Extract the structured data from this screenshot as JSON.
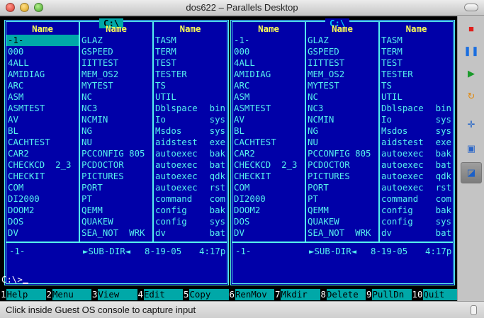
{
  "window": {
    "title": "dos622 – Parallels Desktop"
  },
  "panels": [
    {
      "path": "C:\\",
      "header": "Name",
      "columns": [
        [
          "-1-",
          "000",
          "4ALL",
          "AMIDIAG",
          "ARC",
          "ASM",
          "ASMTEST",
          "AV",
          "BL",
          "CACHTEST",
          "CAR2",
          "CHECKCD  2_3",
          "CHECKIT",
          "COM",
          "DI2000",
          "DOOM2",
          "DOS",
          "DV"
        ],
        [
          "GLAZ",
          "GSPEED",
          "IITTEST",
          "MEM_OS2",
          "MYTEST",
          "NC",
          "NC3",
          "NCMIN",
          "NG",
          "NU",
          "PCCONFIG 805",
          "PCDOCTOR",
          "PICTURES",
          "PORT",
          "PT",
          "QEMM",
          "QUAKEW",
          "SEA_NOT  WRK"
        ],
        [
          [
            "TASM",
            ""
          ],
          [
            "TERM",
            ""
          ],
          [
            "TEST",
            ""
          ],
          [
            "TESTER",
            ""
          ],
          [
            "TS",
            ""
          ],
          [
            "UTIL",
            ""
          ],
          [
            "Dblspace",
            "bin"
          ],
          [
            "Io",
            "sys"
          ],
          [
            "Msdos",
            "sys"
          ],
          [
            "aidstest",
            "exe"
          ],
          [
            "autoexec",
            "bak"
          ],
          [
            "autoexec",
            "bat"
          ],
          [
            "autoexec",
            "qdk"
          ],
          [
            "autoexec",
            "rst"
          ],
          [
            "command",
            "com"
          ],
          [
            "config",
            "bak"
          ],
          [
            "config",
            "sys"
          ],
          [
            "dv",
            "bat"
          ]
        ]
      ],
      "status": {
        "name": "-1-",
        "type": "►SUB-DIR◄",
        "date": "8-19-05",
        "time": "4:17p"
      }
    },
    {
      "path": "C:\\",
      "header": "Name",
      "columns": [
        [
          "-1-",
          "000",
          "4ALL",
          "AMIDIAG",
          "ARC",
          "ASM",
          "ASMTEST",
          "AV",
          "BL",
          "CACHTEST",
          "CAR2",
          "CHECKCD  2_3",
          "CHECKIT",
          "COM",
          "DI2000",
          "DOOM2",
          "DOS",
          "DV"
        ],
        [
          "GLAZ",
          "GSPEED",
          "IITTEST",
          "MEM_OS2",
          "MYTEST",
          "NC",
          "NC3",
          "NCMIN",
          "NG",
          "NU",
          "PCCONFIG 805",
          "PCDOCTOR",
          "PICTURES",
          "PORT",
          "PT",
          "QEMM",
          "QUAKEW",
          "SEA_NOT  WRK"
        ],
        [
          [
            "TASM",
            ""
          ],
          [
            "TERM",
            ""
          ],
          [
            "TEST",
            ""
          ],
          [
            "TESTER",
            ""
          ],
          [
            "TS",
            ""
          ],
          [
            "UTIL",
            ""
          ],
          [
            "Dblspace",
            "bin"
          ],
          [
            "Io",
            "sys"
          ],
          [
            "Msdos",
            "sys"
          ],
          [
            "aidstest",
            "exe"
          ],
          [
            "autoexec",
            "bak"
          ],
          [
            "autoexec",
            "bat"
          ],
          [
            "autoexec",
            "qdk"
          ],
          [
            "autoexec",
            "rst"
          ],
          [
            "command",
            "com"
          ],
          [
            "config",
            "bak"
          ],
          [
            "config",
            "sys"
          ],
          [
            "dv",
            "bat"
          ]
        ]
      ],
      "status": {
        "name": "-1-",
        "type": "►SUB-DIR◄",
        "date": "8-19-05",
        "time": "4:17p"
      }
    }
  ],
  "prompt": "C:\\>",
  "fkeys": [
    {
      "n": "1",
      "label": "Help"
    },
    {
      "n": "2",
      "label": "Menu"
    },
    {
      "n": "3",
      "label": "View"
    },
    {
      "n": "4",
      "label": "Edit"
    },
    {
      "n": "5",
      "label": "Copy"
    },
    {
      "n": "6",
      "label": "RenMov"
    },
    {
      "n": "7",
      "label": "Mkdir"
    },
    {
      "n": "8",
      "label": "Delete"
    },
    {
      "n": "9",
      "label": "PullDn"
    },
    {
      "n": "10",
      "label": "Quit"
    }
  ],
  "sidebar": [
    {
      "name": "stop-icon",
      "glyph": "■",
      "color": "#e0201c"
    },
    {
      "name": "pause-icon",
      "glyph": "❚❚",
      "color": "#1a6ee0"
    },
    {
      "name": "play-icon",
      "glyph": "▶",
      "color": "#1a9a2a"
    },
    {
      "name": "reset-icon",
      "glyph": "↻",
      "color": "#e08a10"
    },
    {
      "name": "fit-window-icon",
      "glyph": "✛",
      "color": "#1a5fc8"
    },
    {
      "name": "screenshot-icon",
      "glyph": "▣",
      "color": "#2b66c8"
    },
    {
      "name": "capture-input-icon",
      "glyph": "◪",
      "color": "#1a5fc8"
    }
  ],
  "statusbar": {
    "message": "Click inside Guest OS console to capture input"
  }
}
